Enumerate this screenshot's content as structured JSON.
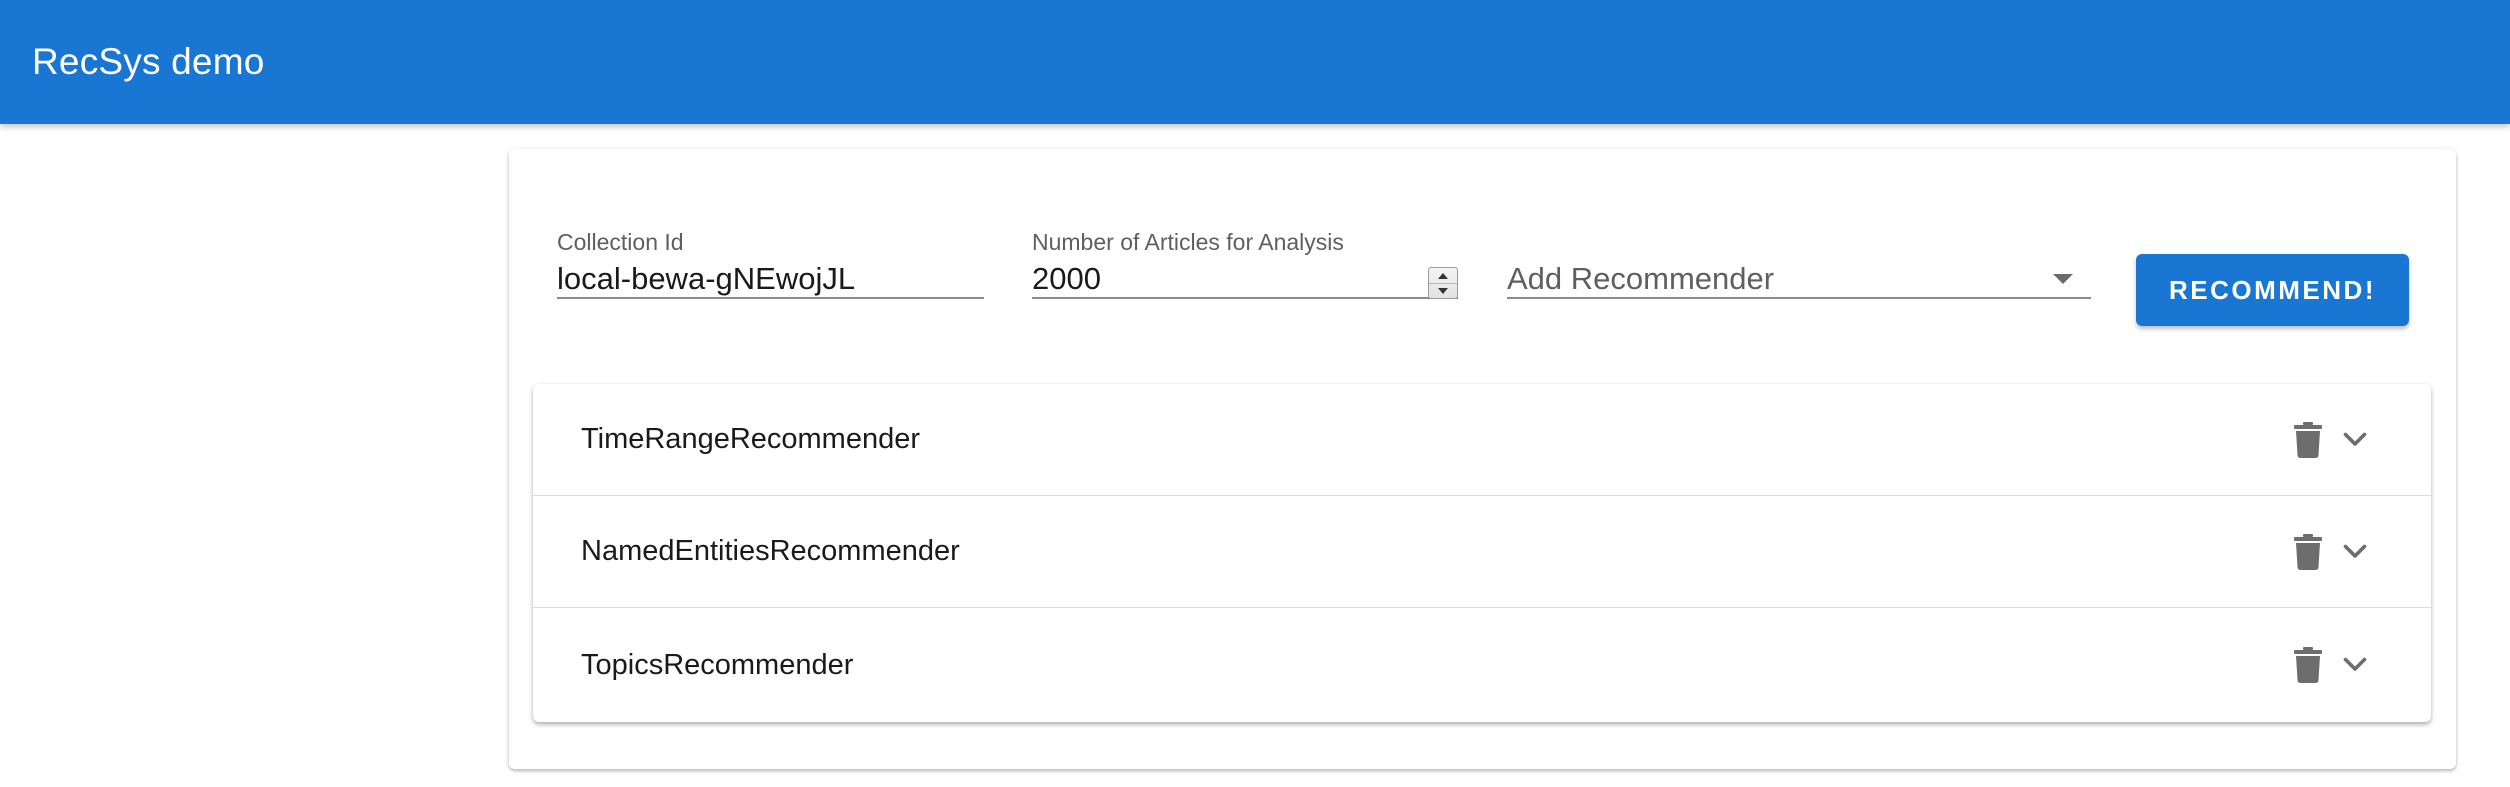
{
  "appbar": {
    "title": "RecSys demo",
    "color": "#1976d2"
  },
  "form": {
    "collection_id": {
      "label": "Collection Id",
      "value": "local-bewa-gNEwojJL"
    },
    "articles": {
      "label": "Number of Articles for Analysis",
      "value": "2000"
    },
    "recommender_select": {
      "placeholder": "Add Recommender",
      "icon": "arrow-drop-down-icon"
    },
    "recommend_button": {
      "label": "RECOMMEND!"
    }
  },
  "recommenders": [
    {
      "title": "TimeRangeRecommender",
      "delete_icon": "trash-icon",
      "expand_icon": "chevron-down-icon"
    },
    {
      "title": "NamedEntitiesRecommender",
      "delete_icon": "trash-icon",
      "expand_icon": "chevron-down-icon"
    },
    {
      "title": "TopicsRecommender",
      "delete_icon": "trash-icon",
      "expand_icon": "chevron-down-icon"
    }
  ]
}
